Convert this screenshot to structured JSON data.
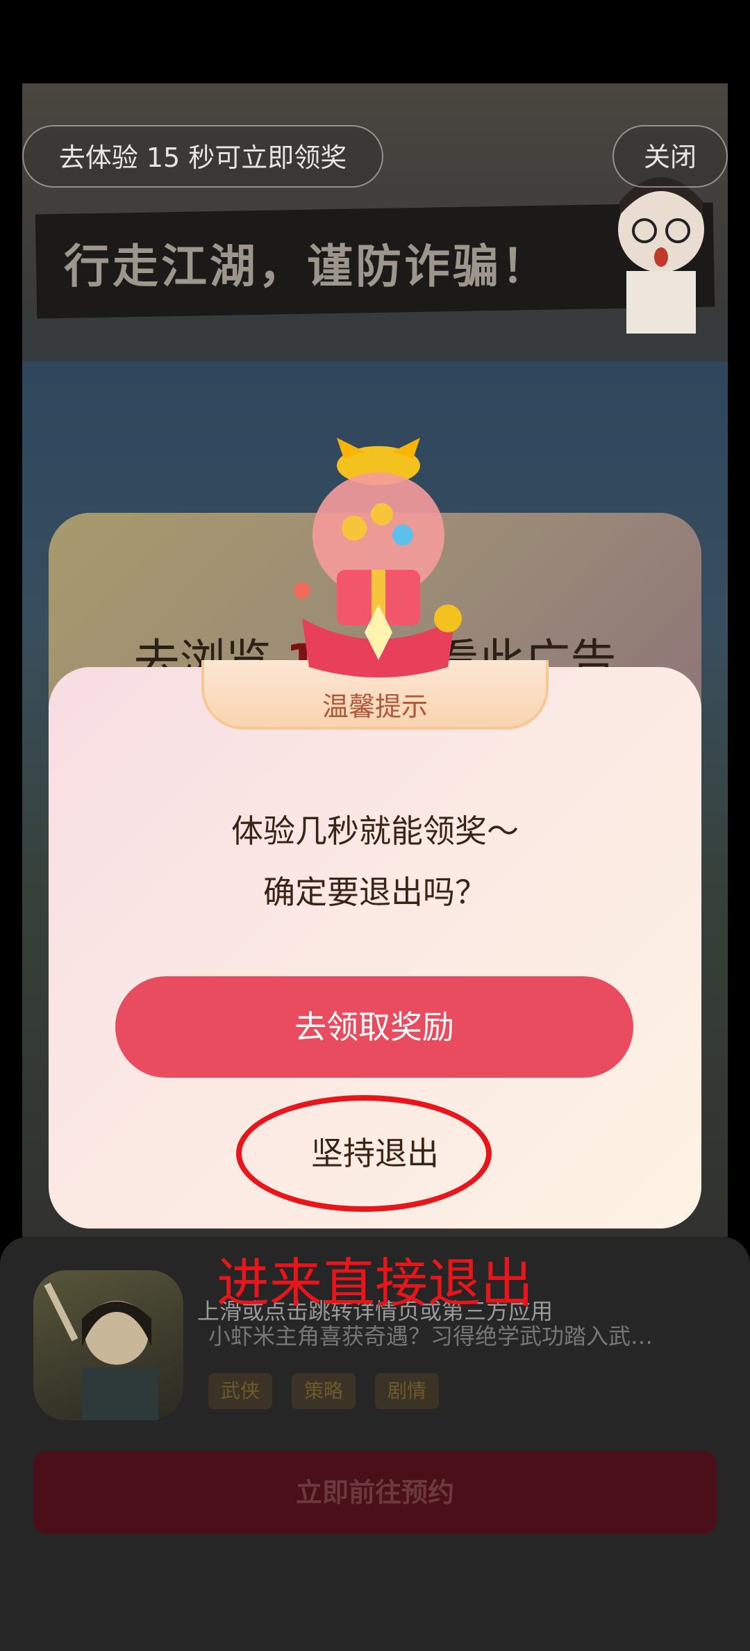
{
  "top_bar": {
    "experience_pill": "去体验 15 秒可立即领奖",
    "close_label": "关闭"
  },
  "ad": {
    "slogan": "行走江湖，谨防诈骗！",
    "back_dialog_prefix": "去浏览 ",
    "back_dialog_number": "15",
    "back_dialog_suffix": "看此广告"
  },
  "dialog": {
    "title": "温馨提示",
    "message_line1": "体验几秒就能领奖～",
    "message_line2": "确定要退出吗？",
    "claim_button": "去领取奖励",
    "exit_button": "坚持退出"
  },
  "annotation": "进来直接退出",
  "bottom_panel": {
    "swipe_hint": "上滑或点击跳转详情页或第三方应用",
    "description": "小虾米主角喜获奇遇？习得绝学武功踏入武…",
    "tags": [
      "武侠",
      "策略",
      "剧情"
    ],
    "reserve_button": "立即前往预约"
  },
  "colors": {
    "accent_red": "#e94b5f",
    "annotation_red": "#e8151b",
    "dialog_title": "#b0563a"
  }
}
